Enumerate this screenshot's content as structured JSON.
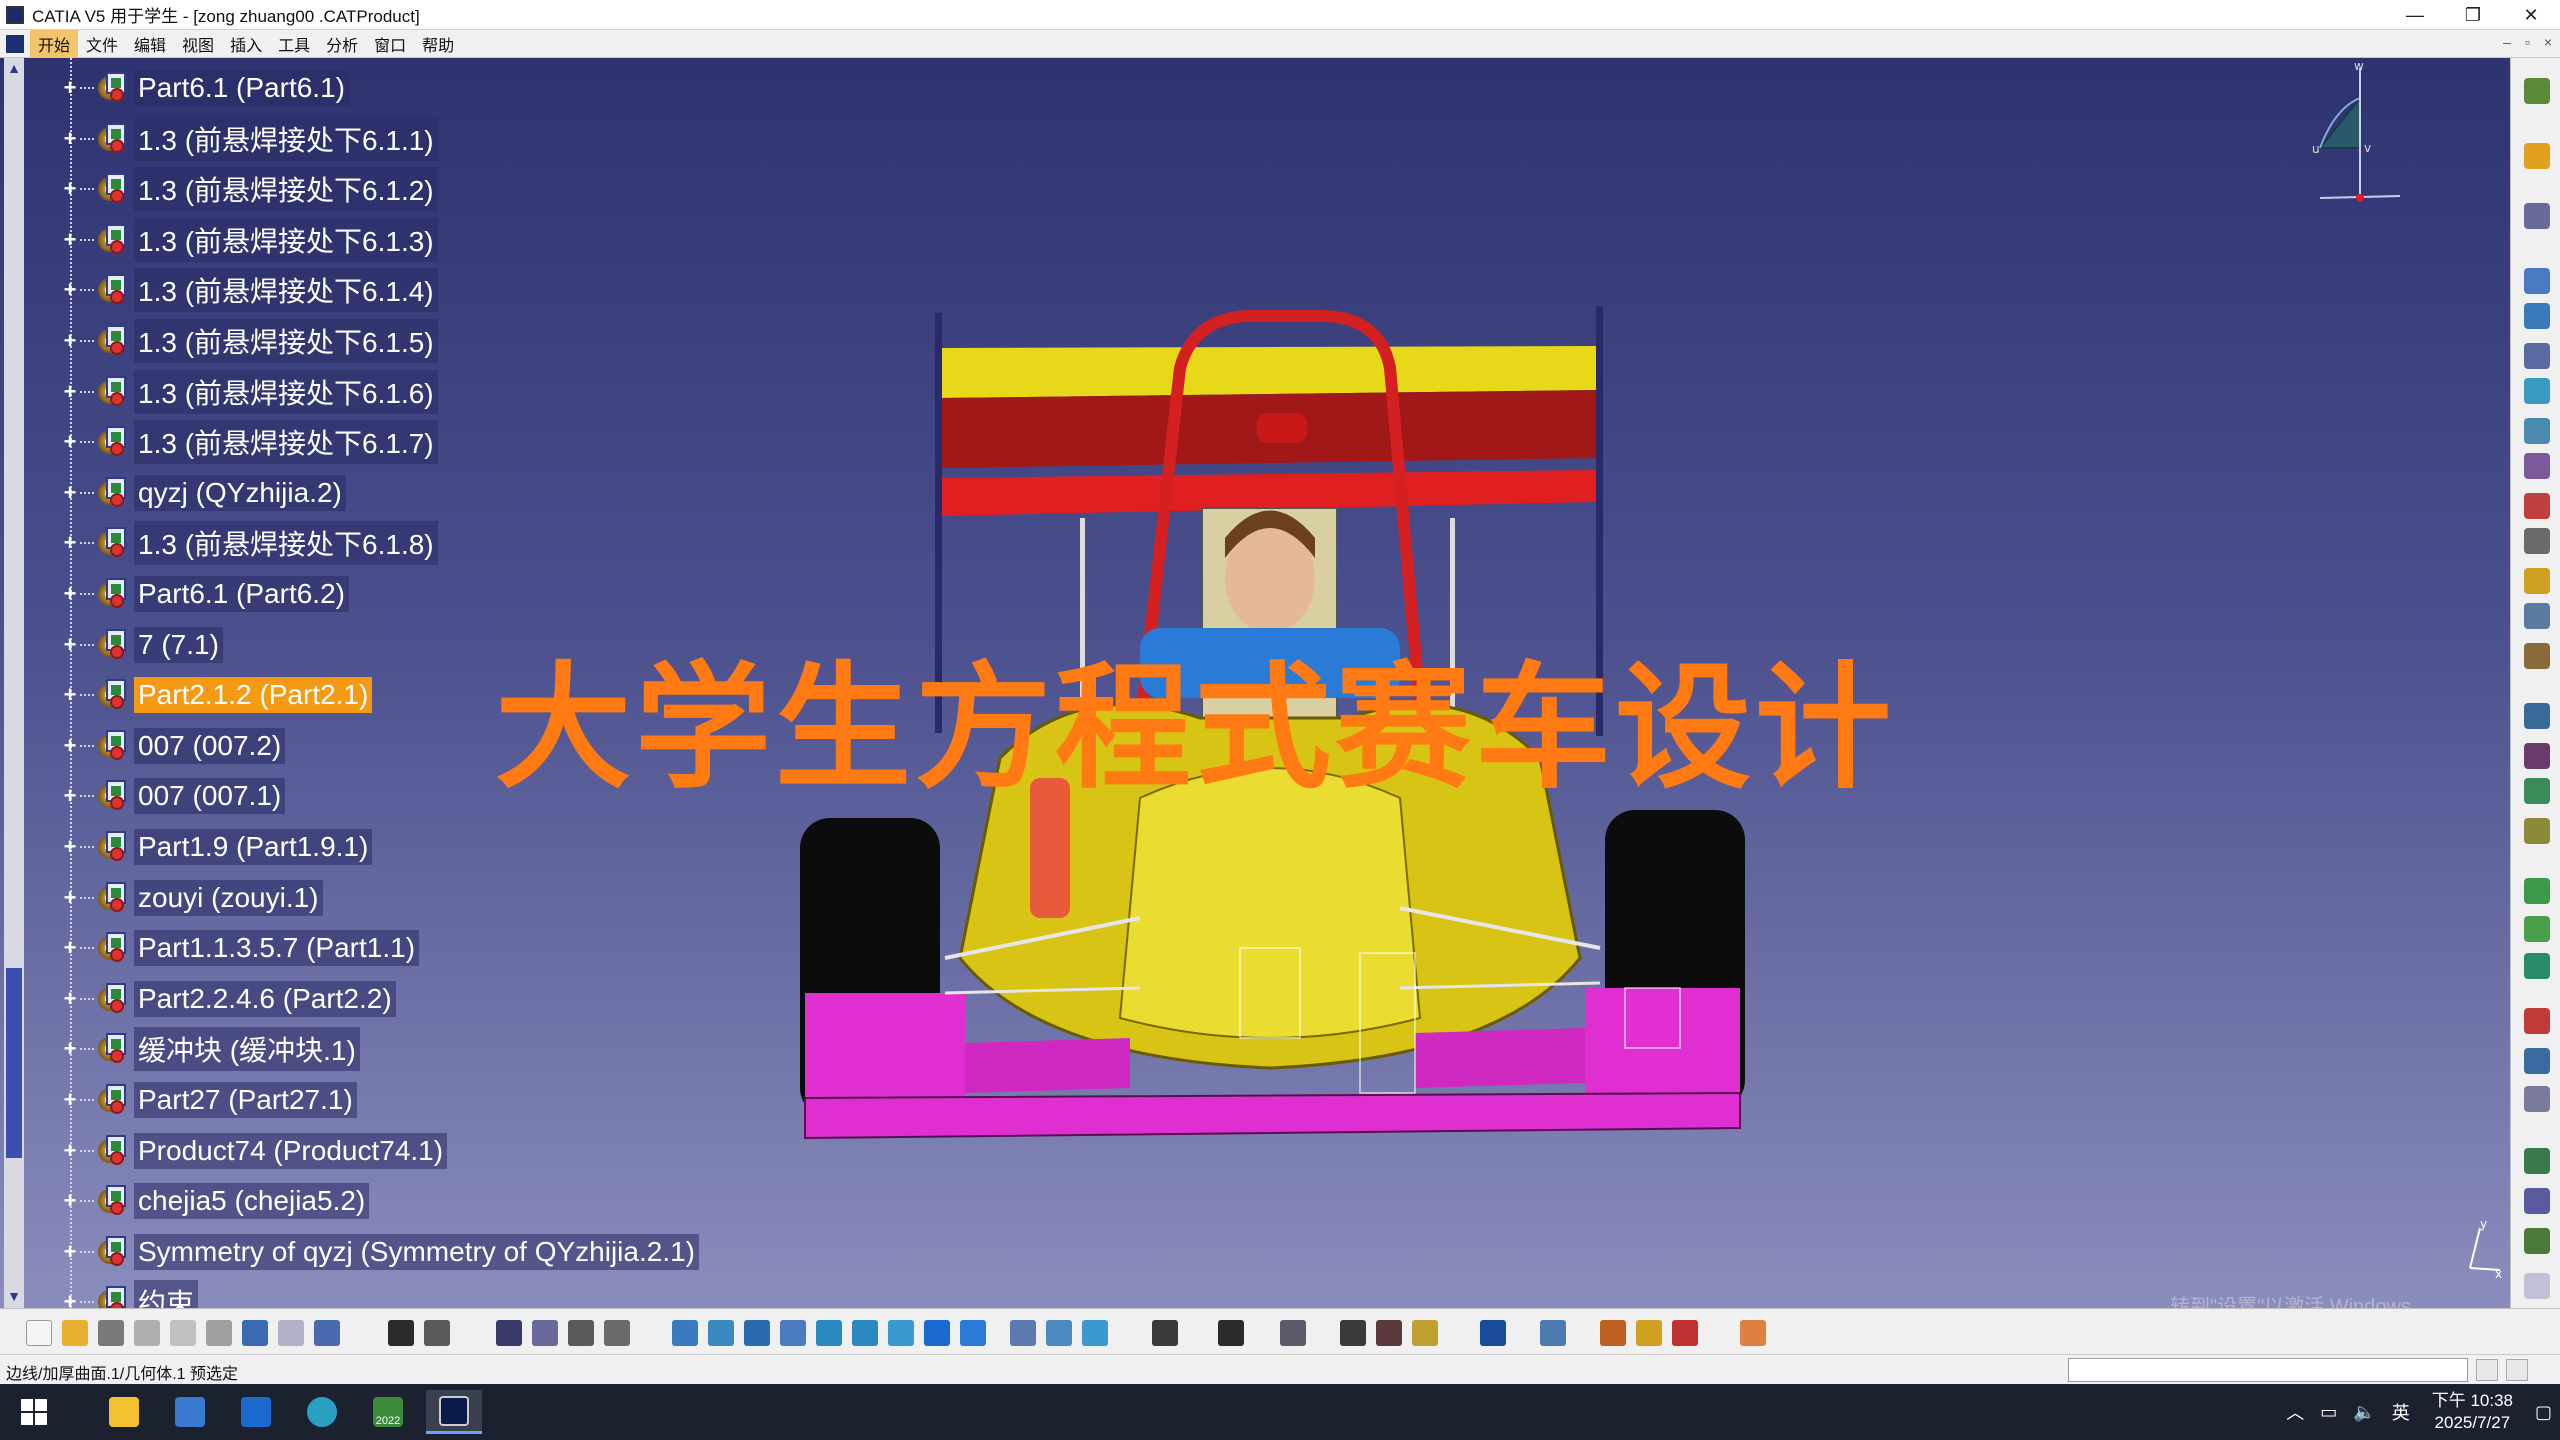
{
  "window": {
    "title": "CATIA V5 用于学生 - [zong zhuang00 .CATProduct]",
    "controls": [
      "—",
      "❐",
      "✕"
    ]
  },
  "menubar": {
    "items": [
      "开始",
      "文件",
      "编辑",
      "视图",
      "插入",
      "工具",
      "分析",
      "窗口",
      "帮助"
    ],
    "active_index": 0
  },
  "tree": {
    "items": [
      {
        "label": "Part6.1 (Part6.1)",
        "selected": false
      },
      {
        "label": "1.3 (前悬焊接处下6.1.1)",
        "selected": false
      },
      {
        "label": "1.3 (前悬焊接处下6.1.2)",
        "selected": false
      },
      {
        "label": "1.3 (前悬焊接处下6.1.3)",
        "selected": false
      },
      {
        "label": "1.3 (前悬焊接处下6.1.4)",
        "selected": false
      },
      {
        "label": "1.3 (前悬焊接处下6.1.5)",
        "selected": false
      },
      {
        "label": "1.3 (前悬焊接处下6.1.6)",
        "selected": false
      },
      {
        "label": "1.3 (前悬焊接处下6.1.7)",
        "selected": false
      },
      {
        "label": "qyzj (QYzhijia.2)",
        "selected": false
      },
      {
        "label": "1.3 (前悬焊接处下6.1.8)",
        "selected": false
      },
      {
        "label": "Part6.1 (Part6.2)",
        "selected": false
      },
      {
        "label": "7 (7.1)",
        "selected": false
      },
      {
        "label": "Part2.1.2 (Part2.1)",
        "selected": true
      },
      {
        "label": "007 (007.2)",
        "selected": false
      },
      {
        "label": "007 (007.1)",
        "selected": false
      },
      {
        "label": "Part1.9 (Part1.9.1)",
        "selected": false
      },
      {
        "label": "zouyi (zouyi.1)",
        "selected": false
      },
      {
        "label": "Part1.1.3.5.7 (Part1.1)",
        "selected": false
      },
      {
        "label": "Part2.2.4.6 (Part2.2)",
        "selected": false
      },
      {
        "label": "缓冲块 (缓冲块.1)",
        "selected": false
      },
      {
        "label": "Part27 (Part27.1)",
        "selected": false
      },
      {
        "label": "Product74 (Product74.1)",
        "selected": false
      },
      {
        "label": "chejia5 (chejia5.2)",
        "selected": false
      },
      {
        "label": "Symmetry of qyzj (Symmetry of QYzhijia.2.1)",
        "selected": false
      },
      {
        "label": "约束",
        "selected": false
      }
    ]
  },
  "overlay": {
    "title": "大学生方程式赛车设计"
  },
  "viewport": {
    "compass_labels": {
      "w": "w",
      "u": "u",
      "v": "v"
    },
    "triad_labels": {
      "y": "y",
      "x": "x"
    },
    "watermark": "转到\"设置\"以激活 Windows。"
  },
  "statusbar": {
    "text": "边线/加厚曲面.1/几何体.1 预选定",
    "input_value": ""
  },
  "taskbar": {
    "time": "下午 10:38",
    "date": "2025/7/27",
    "ime": "英",
    "idea_badge": "2022"
  },
  "colors": {
    "viewport_top": "#2e3370",
    "viewport_bottom": "#8a8dbc",
    "selection": "#f59a15",
    "overlay_text": "#ff7a12",
    "car_yellow": "#e8d81a",
    "car_red": "#d81e1e",
    "car_magenta": "#e02fd0"
  }
}
